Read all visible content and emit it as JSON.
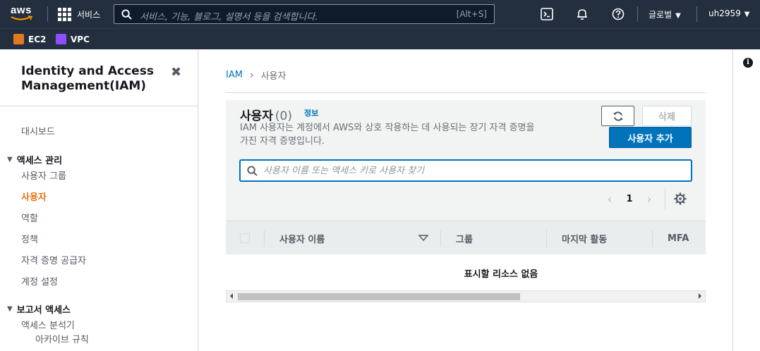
{
  "topnav": {
    "logo_text": "aws",
    "services_label": "서비스",
    "search_placeholder": "서비스, 기능, 블로그, 설명서 등을 검색합니다.",
    "search_shortcut": "[Alt+S]",
    "region_label": "글로벌",
    "account_label": "uh2959"
  },
  "favorites": [
    {
      "label": "EC2",
      "color": "#e07a1f",
      "icon": "ec2-icon"
    },
    {
      "label": "VPC",
      "color": "#8c4fff",
      "icon": "vpc-icon"
    }
  ],
  "sidebar": {
    "title": "Identity and Access Management(IAM)",
    "close_icon": "close-icon",
    "dashboard": "대시보드",
    "access_mgmt": {
      "label": "액세스 관리",
      "items": [
        "사용자 그룹",
        "사용자",
        "역할",
        "정책",
        "자격 증명 공급자",
        "계정 설정"
      ]
    },
    "active_item": "사용자",
    "report_access": {
      "label": "보고서 액세스",
      "items": [
        "액세스 분석기"
      ],
      "sub_items": [
        "아카이브 규칙"
      ]
    }
  },
  "breadcrumb": {
    "root": "IAM",
    "current": "사용자"
  },
  "panel": {
    "title": "사용자",
    "count": "(0)",
    "info_link": "정보",
    "description": "IAM 사용자는 계정에서 AWS와 상호 작용하는 데 사용되는 장기 자격 증명을 가진 자격 증명입니다.",
    "delete_label": "삭제",
    "add_label": "사용자 추가",
    "filter_placeholder": "사용자 이름 또는 액세스 키로 사용자 찾기",
    "filter_value": "",
    "page_number": "1"
  },
  "table": {
    "columns": [
      "사용자 이름",
      "그룹",
      "마지막 활동",
      "MFA"
    ],
    "empty_message": "표시할 리소스 없음"
  },
  "colors": {
    "nav_bg": "#232f3e",
    "primary": "#0073bb",
    "active_orange": "#ec7211"
  }
}
